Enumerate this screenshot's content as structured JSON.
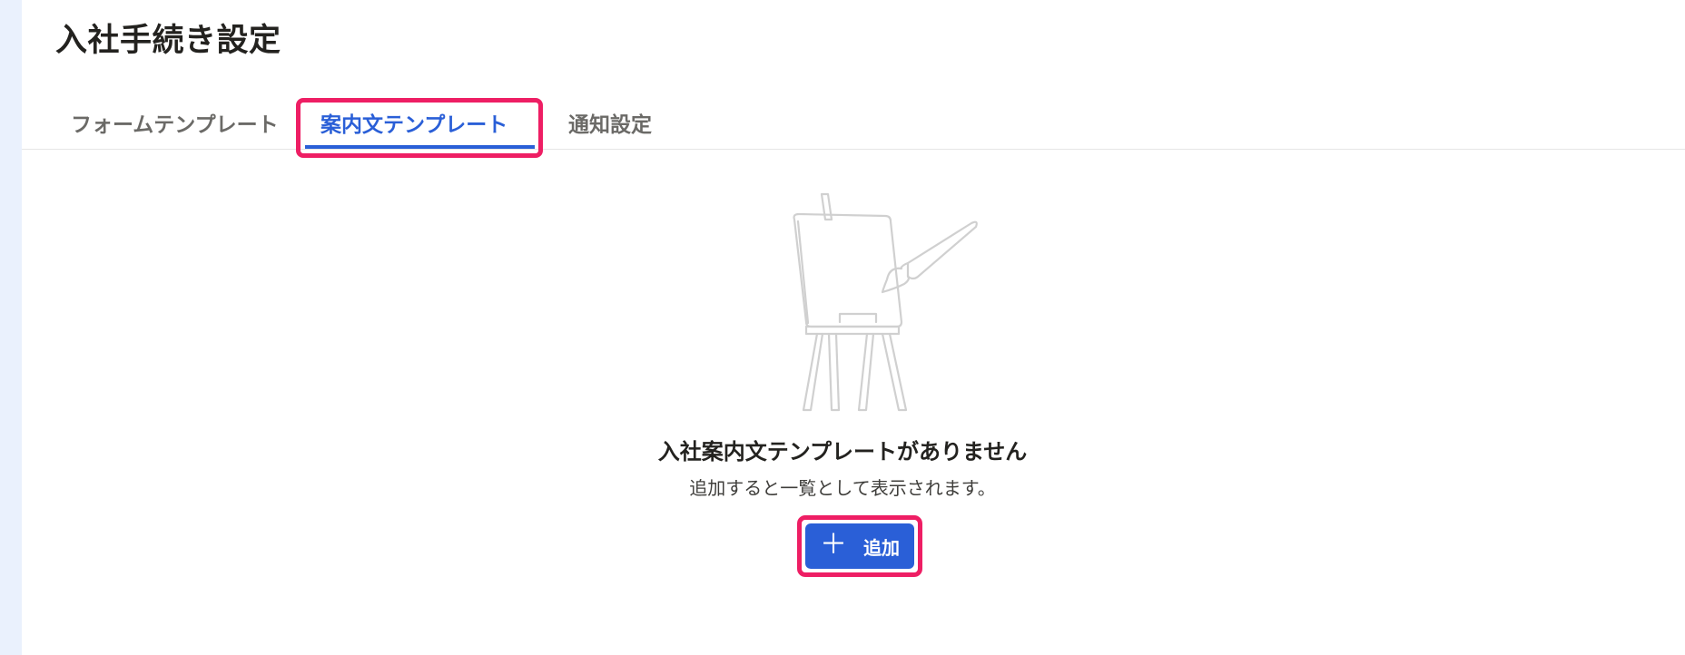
{
  "page": {
    "title": "入社手続き設定"
  },
  "tabs": [
    {
      "label": "フォームテンプレート",
      "active": false
    },
    {
      "label": "案内文テンプレート",
      "active": true
    },
    {
      "label": "通知設定",
      "active": false
    }
  ],
  "empty_state": {
    "illustration": "easel-paintbrush-illustration",
    "title": "入社案内文テンプレートがありません",
    "description": "追加すると一覧として表示されます。"
  },
  "actions": {
    "add_label": "追加",
    "add_icon": "plus-icon"
  },
  "colors": {
    "accent": "#2a5fd7",
    "highlight": "#ee1e64",
    "sidebar": "#eaf1fd",
    "illustration_stroke": "#d0d0d0"
  }
}
